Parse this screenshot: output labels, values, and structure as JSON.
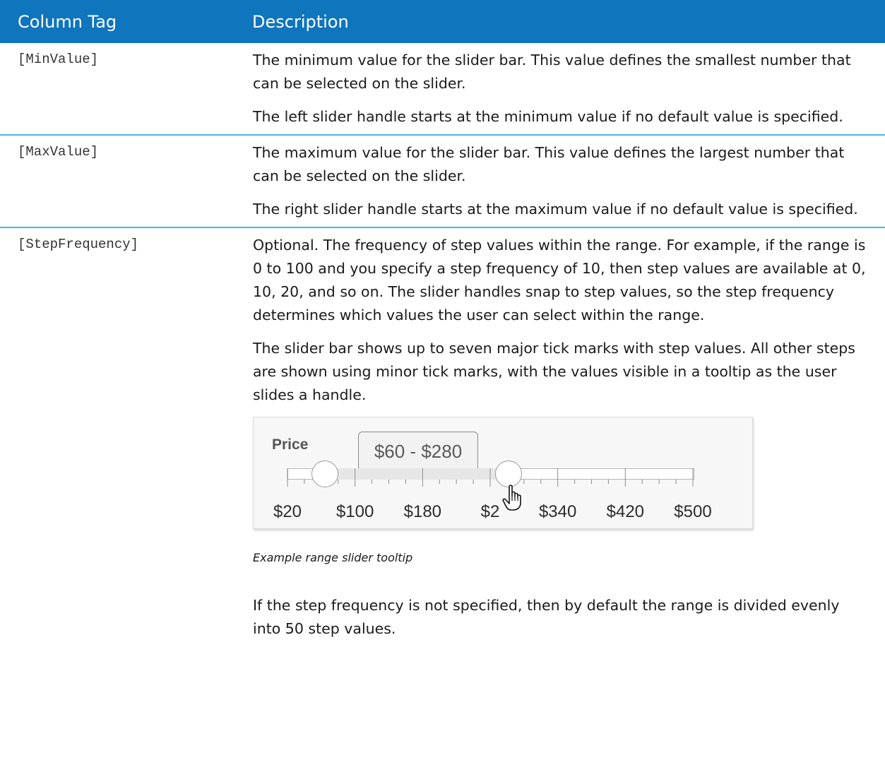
{
  "header": {
    "col1": "Column Tag",
    "col2": "Description"
  },
  "rows": [
    {
      "tag": "[MinValue]",
      "paragraphs": [
        "The minimum value for the slider bar. This value defines the smallest number that can be selected on the slider.",
        "The left slider handle starts at the minimum value if no default value is specified."
      ]
    },
    {
      "tag": "[MaxValue]",
      "paragraphs": [
        "The maximum value for the slider bar. This value defines the largest number that can be selected on the slider.",
        "The right slider handle starts at the maximum value if no default value is specified."
      ]
    },
    {
      "tag": "[StepFrequency]",
      "paragraphs": [
        "Optional. The frequency of step values within the range. For example, if the range is 0 to 100 and you specify a step frequency of 10, then step values are available at 0, 10, 20, and so on. The slider handles snap to step values, so the step frequency determines which values the user can select within the range.",
        "The slider bar shows up to seven major tick marks with step values. All other steps are shown using minor tick marks, with the values visible in a tooltip as the user slides a handle.",
        "If the step frequency is not specified, then by default the range is divided evenly into 50 step values."
      ]
    }
  ],
  "slider_example": {
    "title": "Price",
    "tooltip": "$60 - $280",
    "min": 20,
    "max": 500,
    "low_value": 60,
    "high_value": 280,
    "tick_labels": [
      "$20",
      "$100",
      "$180",
      "$2",
      "$340",
      "$420",
      "$500"
    ],
    "caption": "Example range slider tooltip",
    "cursor_icon": "hand-pointer-icon"
  },
  "colors": {
    "header_bg": "#0f75bc",
    "row_divider": "#49b7e4"
  }
}
